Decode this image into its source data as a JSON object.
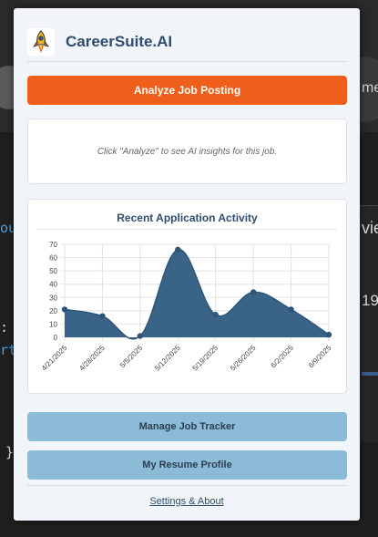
{
  "background": {
    "partial_text_right": "me",
    "partial_right_1": "vie",
    "partial_right_2": "19",
    "code_fragments": [
      "ou",
      ":",
      "rt",
      "}"
    ]
  },
  "popup": {
    "brand": "CareerSuite.AI",
    "logo_icon": "rocket-icon",
    "analyze_button": "Analyze Job Posting",
    "insight_placeholder": "Click \"Analyze\" to see AI insights for this job.",
    "manage_button": "Manage Job Tracker",
    "resume_button": "My Resume Profile",
    "settings_link": "Settings & About",
    "colors": {
      "accent": "#ee5f1c",
      "brand": "#2f4d6f",
      "secondary_button": "#8bbbd6",
      "chart_fill": "#3a6487"
    }
  },
  "chart_data": {
    "type": "area",
    "title": "Recent Application Activity",
    "x": [
      "4/21/2025",
      "4/28/2025",
      "5/5/2025",
      "5/12/2025",
      "5/19/2025",
      "5/26/2025",
      "6/2/2025",
      "6/9/2025"
    ],
    "values": [
      21,
      16,
      1,
      66,
      17,
      34,
      21,
      2
    ],
    "yticks": [
      0,
      10,
      20,
      30,
      40,
      50,
      60,
      70
    ],
    "ylim": [
      0,
      70
    ],
    "smooth": true,
    "legend": "none",
    "grid": true
  }
}
